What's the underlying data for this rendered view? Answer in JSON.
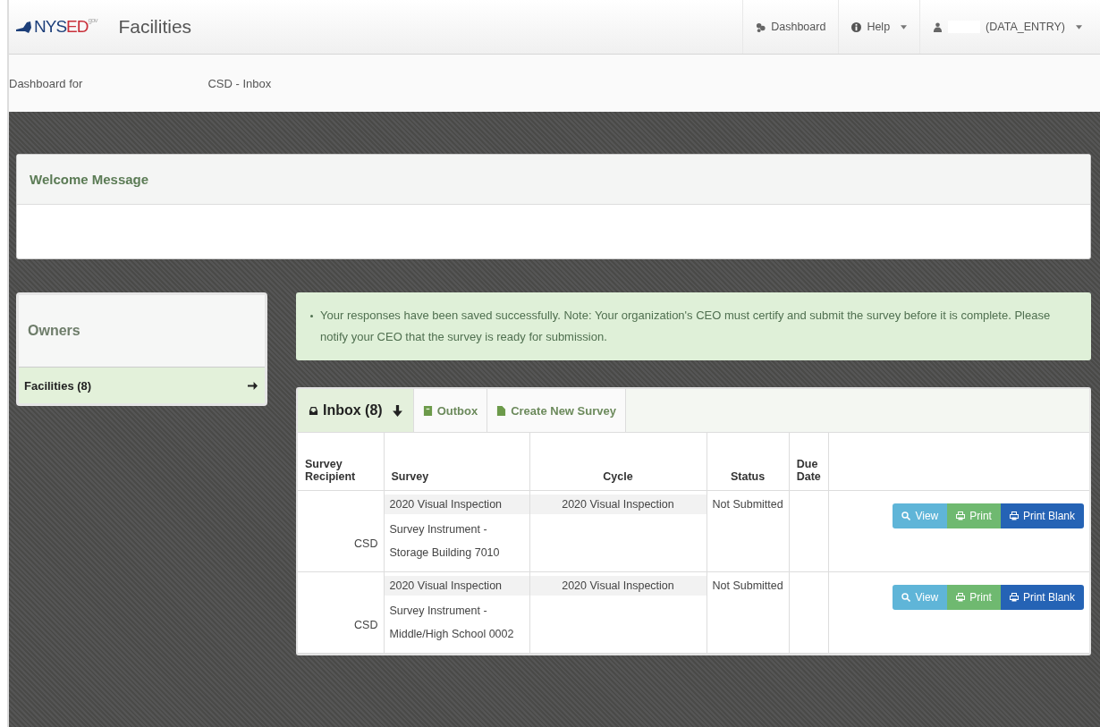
{
  "navbar": {
    "logo": {
      "main": "NYS",
      "accent": "ED",
      "suffix": "gov"
    },
    "title": "Facilities",
    "items": [
      {
        "kind": "dashboard",
        "label": "Dashboard"
      },
      {
        "kind": "help",
        "label": "Help"
      },
      {
        "kind": "user",
        "label": "(DATA_ENTRY)"
      }
    ]
  },
  "breadcrumb": {
    "prefix": "Dashboard for",
    "page": "CSD - Inbox"
  },
  "welcome_panel": {
    "title": "Welcome Message"
  },
  "sidebar": {
    "title": "Owners",
    "items": [
      {
        "label": "Facilities (8)",
        "selected": true
      }
    ]
  },
  "alert": {
    "message": "Your responses have been saved successfully. Note: Your organization's CEO must certify and submit the survey before it is complete. Please notify your CEO that the survey is ready for submission."
  },
  "tabs": [
    {
      "kind": "inbox",
      "label": "Inbox (8)",
      "selected": true
    },
    {
      "kind": "outbox",
      "label": "Outbox",
      "selected": false
    },
    {
      "kind": "create",
      "label": "Create New Survey",
      "selected": false
    }
  ],
  "table": {
    "columns": [
      "Survey Recipient",
      "Survey",
      "Cycle",
      "Status",
      "Due Date"
    ],
    "rows": [
      {
        "recipient": "CSD",
        "survey_line_1": "2020 Visual Inspection",
        "survey_rest": "Survey Instrument - Storage Building 7010",
        "cycle": "2020 Visual Inspection",
        "status": "Not Submitted",
        "actions": [
          {
            "kind": "view",
            "label": "View"
          },
          {
            "kind": "print",
            "label": "Print"
          },
          {
            "kind": "blank",
            "label": "Print Blank"
          }
        ]
      },
      {
        "recipient": "CSD",
        "survey_line_1": "2020 Visual Inspection",
        "survey_rest": "Survey Instrument - Middle/High School 0002",
        "cycle": "2020 Visual Inspection",
        "status": "Not Submitted",
        "actions": [
          {
            "kind": "view",
            "label": "View"
          },
          {
            "kind": "print",
            "label": "Print"
          },
          {
            "kind": "blank",
            "label": "Print Blank"
          }
        ]
      }
    ]
  }
}
